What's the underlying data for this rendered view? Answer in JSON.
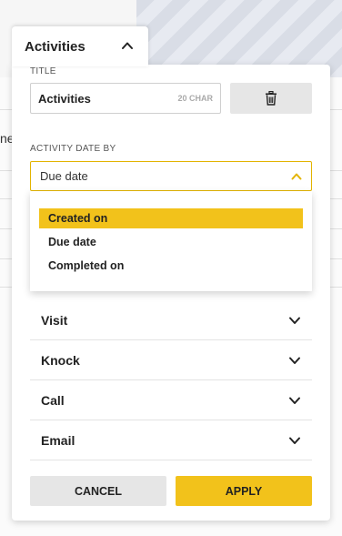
{
  "background": {
    "left_text": "ne"
  },
  "tab": {
    "title": "Activities"
  },
  "title_field": {
    "label": "TITLE",
    "value": "Activities",
    "counter": "20 CHAR"
  },
  "date_by": {
    "label": "ACTIVITY DATE BY",
    "selected": "Due date",
    "options": [
      {
        "label": "Created on",
        "highlighted": true
      },
      {
        "label": "Due date",
        "highlighted": false
      },
      {
        "label": "Completed on",
        "highlighted": false
      }
    ]
  },
  "accordion": [
    {
      "label": "Visit"
    },
    {
      "label": "Knock"
    },
    {
      "label": "Call"
    },
    {
      "label": "Email"
    }
  ],
  "buttons": {
    "cancel": "CANCEL",
    "apply": "APPLY"
  },
  "colors": {
    "accent": "#f2c21b",
    "select_border": "#e3b400",
    "secondary_button": "#e6e6e6"
  }
}
